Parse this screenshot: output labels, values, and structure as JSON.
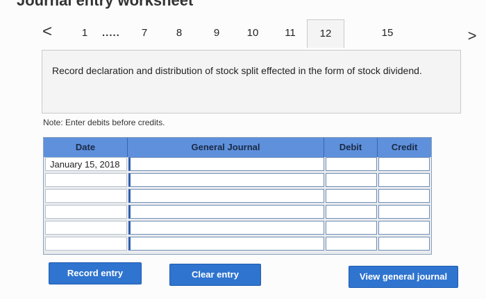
{
  "header": {
    "title": "Journal entry worksheet"
  },
  "tabs": {
    "prev_label": "<",
    "next_label": ">",
    "ellipsis": ".....",
    "items": [
      {
        "label": "1"
      },
      {
        "label": "7"
      },
      {
        "label": "8"
      },
      {
        "label": "9"
      },
      {
        "label": "10"
      },
      {
        "label": "11"
      },
      {
        "label": "12",
        "active": true
      },
      {
        "label": "15"
      }
    ]
  },
  "instruction": {
    "text": "Record declaration and distribution of stock split effected in the form of stock dividend."
  },
  "note": "Note: Enter debits before credits.",
  "journal": {
    "columns": [
      "Date",
      "General Journal",
      "Debit",
      "Credit"
    ],
    "rows": [
      {
        "date": "January 15, 2018",
        "account": "",
        "debit": "",
        "credit": ""
      },
      {
        "date": "",
        "account": "",
        "debit": "",
        "credit": ""
      },
      {
        "date": "",
        "account": "",
        "debit": "",
        "credit": ""
      },
      {
        "date": "",
        "account": "",
        "debit": "",
        "credit": ""
      },
      {
        "date": "",
        "account": "",
        "debit": "",
        "credit": ""
      },
      {
        "date": "",
        "account": "",
        "debit": "",
        "credit": ""
      }
    ]
  },
  "buttons": {
    "record": "Record entry",
    "clear": "Clear entry",
    "view": "View general journal"
  },
  "colors": {
    "accent": "#2f74cf",
    "header": "#5e90dc"
  }
}
